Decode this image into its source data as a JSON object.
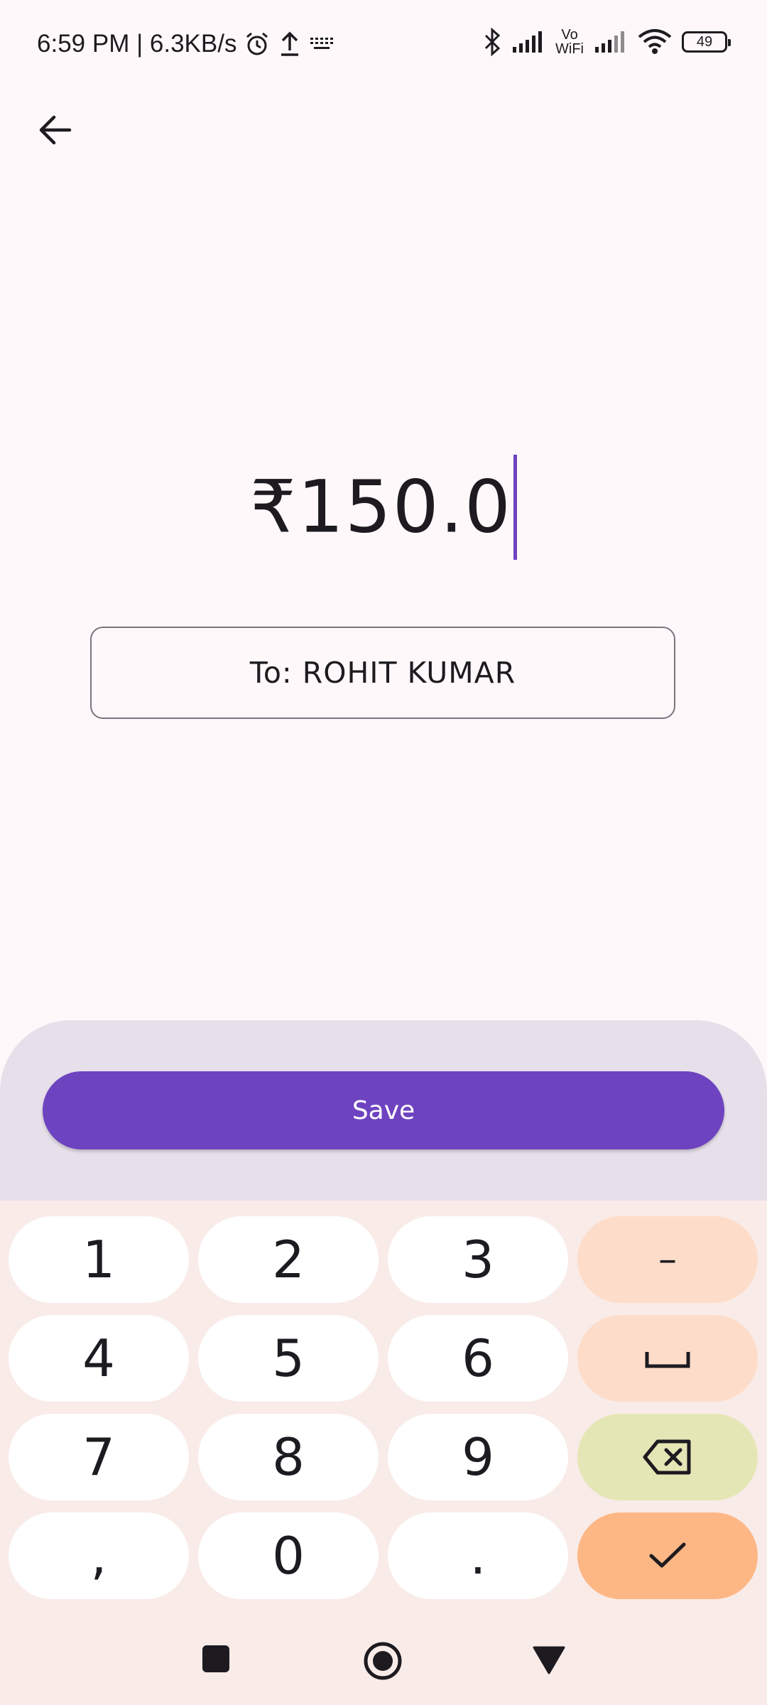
{
  "status_bar": {
    "time_and_speed": "6:59 PM | 6.3KB/s",
    "vowifi_label_top": "Vo",
    "vowifi_label_bottom": "WiFi",
    "battery_level": "49",
    "icons": [
      "alarm-icon",
      "upload-icon",
      "keyboard-icon",
      "bluetooth-icon",
      "signal-icon",
      "wifi-icon",
      "battery-icon"
    ]
  },
  "header": {
    "back_icon": "arrow-left-icon"
  },
  "amount": {
    "value": "₹150.0"
  },
  "recipient": {
    "label": "To: ROHIT KUMAR"
  },
  "actions": {
    "save_label": "Save"
  },
  "keypad": {
    "rows": [
      [
        "1",
        "2",
        "3",
        "–"
      ],
      [
        "4",
        "5",
        "6",
        "space"
      ],
      [
        "7",
        "8",
        "9",
        "backspace"
      ],
      [
        ",",
        "0",
        ".",
        "done"
      ]
    ],
    "labels": {
      "k1": "1",
      "k2": "2",
      "k3": "3",
      "minus": "–",
      "k4": "4",
      "k5": "5",
      "k6": "6",
      "k7": "7",
      "k8": "8",
      "k9": "9",
      "comma": ",",
      "k0": "0",
      "dot": "."
    }
  },
  "nav_bar": {
    "icons": [
      "recents-square-icon",
      "home-circle-icon",
      "back-triangle-icon"
    ]
  },
  "colors": {
    "accent": "#6e43c0",
    "background": "#fff8fa",
    "sheet": "#e7e0eb",
    "keyboard_bg": "#f9ebe8",
    "key_peach": "#fdddc9",
    "key_green": "#e5e6b5",
    "key_orange": "#fdb784"
  }
}
